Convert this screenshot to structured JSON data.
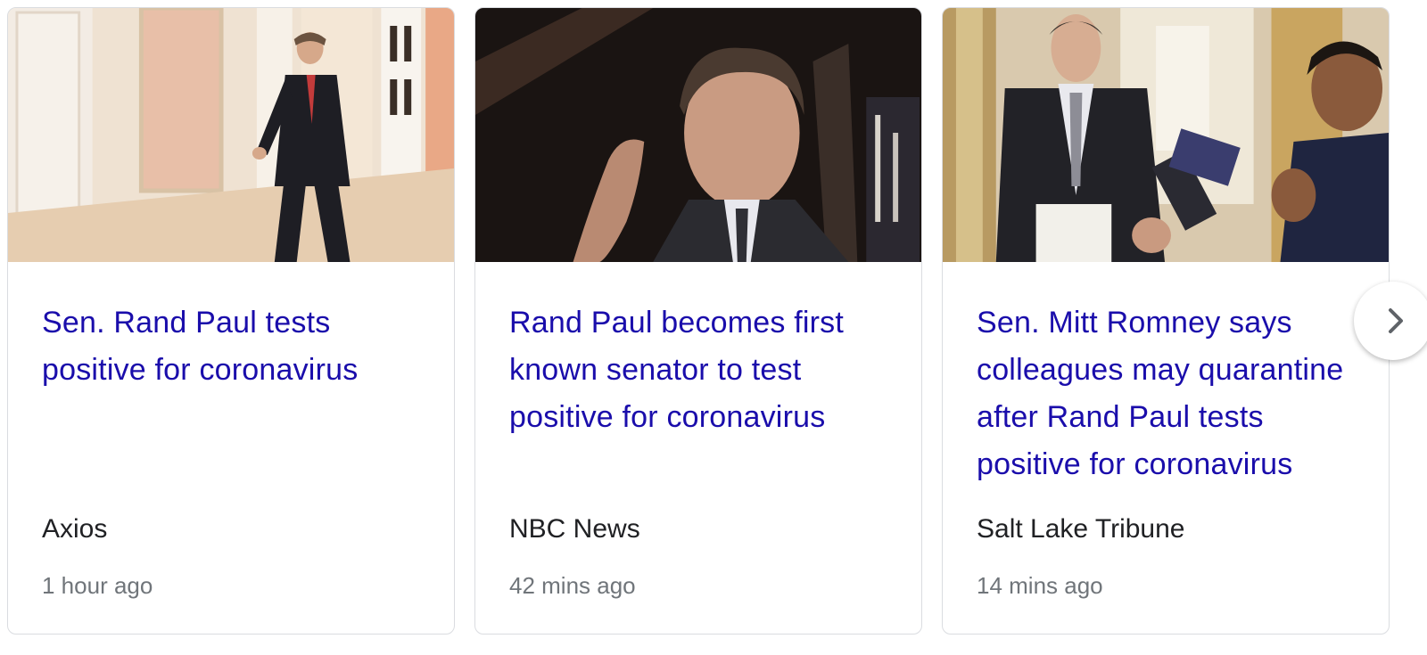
{
  "stories": [
    {
      "headline": "Sen. Rand Paul tests positive for coronavirus",
      "source": "Axios",
      "time": "1 hour ago",
      "image": "photo-man-walking-corridor"
    },
    {
      "headline": "Rand Paul becomes first known senator to test positive for coronavirus",
      "source": "NBC News",
      "time": "42 mins ago",
      "image": "photo-man-speaking-dark-background"
    },
    {
      "headline": "Sen. Mitt Romney says colleagues may quarantine after Rand Paul tests positive for coronavirus",
      "source": "Salt Lake Tribune",
      "time": "14 mins ago",
      "image": "photo-man-with-reporters-hallway"
    }
  ],
  "next_button_icon": "chevron-right-icon",
  "colors": {
    "headline": "#1a0dab",
    "source": "#202124",
    "time": "#70757a",
    "border": "#dadce0"
  }
}
